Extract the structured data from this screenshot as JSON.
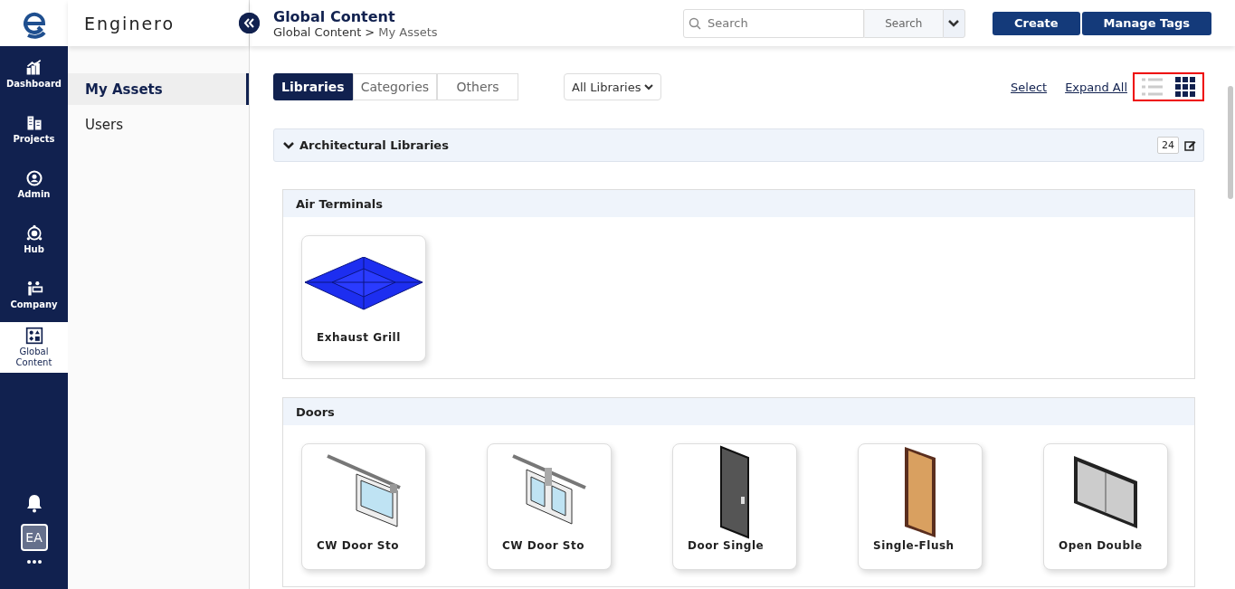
{
  "app": {
    "logo_text": "Enginero"
  },
  "rail": {
    "items": [
      {
        "label": "Dashboard",
        "kind": "chart",
        "selected": false
      },
      {
        "label": "Projects",
        "kind": "buildings",
        "selected": false
      },
      {
        "label": "Admin",
        "kind": "admin",
        "selected": false
      },
      {
        "label": "Hub",
        "kind": "hub",
        "selected": false
      },
      {
        "label": "Company",
        "kind": "company",
        "selected": false
      },
      {
        "label": "Global Content",
        "kind": "shapes",
        "selected": true
      }
    ],
    "avatar": "EA"
  },
  "sidebar": {
    "items": [
      {
        "label": "My Assets",
        "selected": true
      },
      {
        "label": "Users",
        "selected": false
      }
    ]
  },
  "header": {
    "title": "Global Content",
    "breadcrumb": [
      "Global Content",
      "My Assets"
    ],
    "separator": ">",
    "search": {
      "placeholder": "Search",
      "scope": "Search"
    },
    "buttons": [
      "Create",
      "Manage Tags"
    ]
  },
  "toolbar": {
    "tabs": [
      {
        "label": "Libraries",
        "selected": true
      },
      {
        "label": "Categories",
        "selected": false
      },
      {
        "label": "Others",
        "selected": false
      }
    ],
    "filter": "All Libraries",
    "links": [
      "Select",
      "Expand All"
    ],
    "views": [
      {
        "kind": "list",
        "selected": false
      },
      {
        "kind": "grid",
        "selected": true
      }
    ]
  },
  "library": {
    "title": "Architectural Libraries",
    "expanded": true,
    "count": "24",
    "groups": [
      {
        "title": "Air Terminals",
        "items": [
          {
            "name": "Exhaust Grill",
            "kind": "grill"
          }
        ]
      },
      {
        "title": "Doors",
        "items": [
          {
            "name": "CW Door Sto",
            "kind": "sliding-single"
          },
          {
            "name": "CW Door Sto",
            "kind": "sliding-double"
          },
          {
            "name": "Door Single",
            "kind": "dark-door"
          },
          {
            "name": "Single-Flush",
            "kind": "wood-door"
          },
          {
            "name": "Open Double",
            "kind": "double-door"
          }
        ]
      }
    ]
  }
}
